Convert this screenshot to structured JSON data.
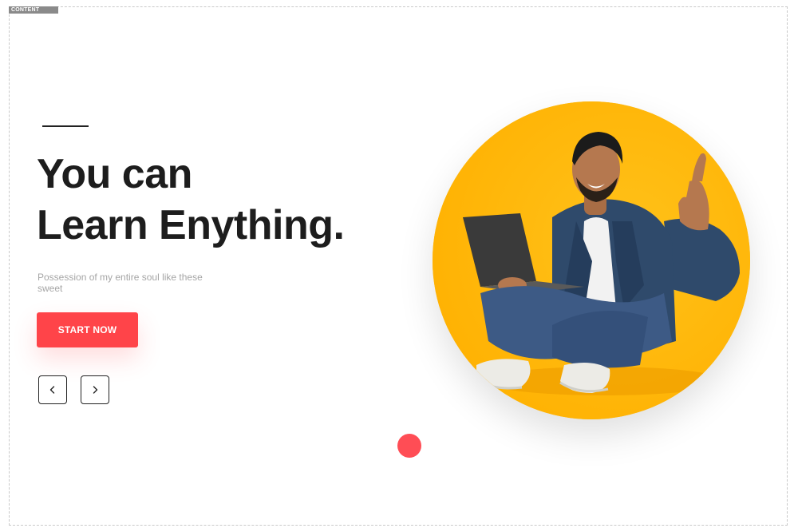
{
  "canvas_label": "CONTENT",
  "hero": {
    "title_line1": "You can",
    "title_line2": "Learn Enything.",
    "subtitle": "Possession of my entire soul like these sweet",
    "cta_label": "START NOW",
    "image_alt": "Smiling man sitting cross-legged with a laptop giving a thumbs up"
  },
  "slider": {
    "prev_icon": "chevron-left-icon",
    "next_icon": "chevron-right-icon"
  },
  "colors": {
    "accent": "#ff4449",
    "circle": "#ffb90f",
    "text_dark": "#1d1d1d",
    "text_muted": "#a5a5a5"
  }
}
